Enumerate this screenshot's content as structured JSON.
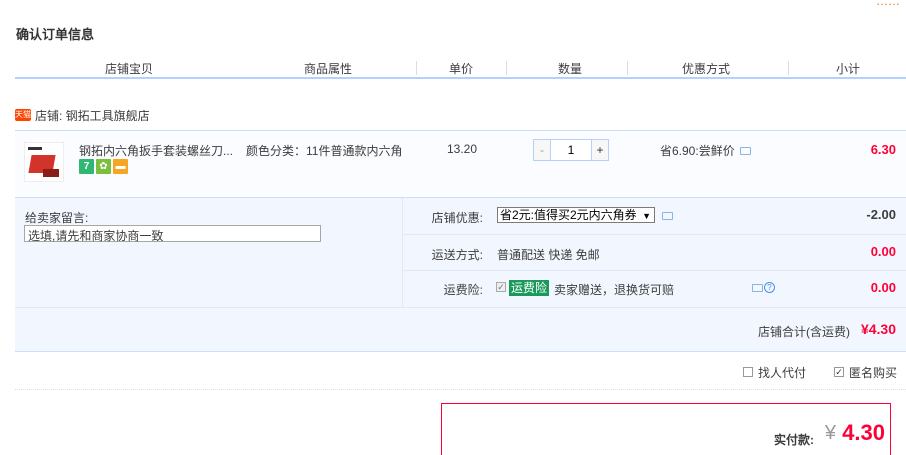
{
  "page": {
    "corner_link": "……",
    "title": "确认订单信息"
  },
  "table_header": {
    "columns": [
      "店铺宝贝",
      "商品属性",
      "单价",
      "数量",
      "优惠方式",
      "小计"
    ]
  },
  "shop": {
    "icon_text": "天猫",
    "label": "店铺: 钢拓工具旗舰店"
  },
  "item": {
    "title": "钢拓内六角扳手套装螺丝刀...",
    "badges": [
      "7",
      "✿",
      "▬"
    ],
    "attribute": "颜色分类：11件普通款内六角",
    "unit_price": "13.20",
    "quantity": "1",
    "qty_minus": "-",
    "qty_plus": "+",
    "promotion": "省6.90:尝鲜价",
    "subtotal": "6.30"
  },
  "order": {
    "memo_label": "给卖家留言:",
    "memo_placeholder": "选填,请先和商家协商一致",
    "coupon_label": "店铺优惠:",
    "coupon_selected": "省2元:值得买2元内六角券",
    "coupon_amount": "-2.00",
    "shipping_label": "运送方式:",
    "shipping_value": "普通配送 快递 免邮",
    "shipping_amount": "0.00",
    "insurance_label": "运费险:",
    "insurance_tag": "运费险",
    "insurance_desc": "卖家赠送，退换货可赔",
    "insurance_amount": "0.00",
    "shop_total_label": "店铺合计(含运费)",
    "shop_total_value": "¥4.30"
  },
  "options": {
    "proxy_pay_label": "找人代付",
    "proxy_pay_checked": false,
    "anonymous_label": "匿名购买",
    "anonymous_checked": true
  },
  "payment": {
    "label": "实付款:",
    "currency": "¥",
    "value": "4.30"
  },
  "colors": {
    "accent_red": "#ff0036",
    "header_line": "#b2d1ff",
    "panel_bg": "#f2f7ff",
    "insurance_green": "#1a9a5a"
  }
}
